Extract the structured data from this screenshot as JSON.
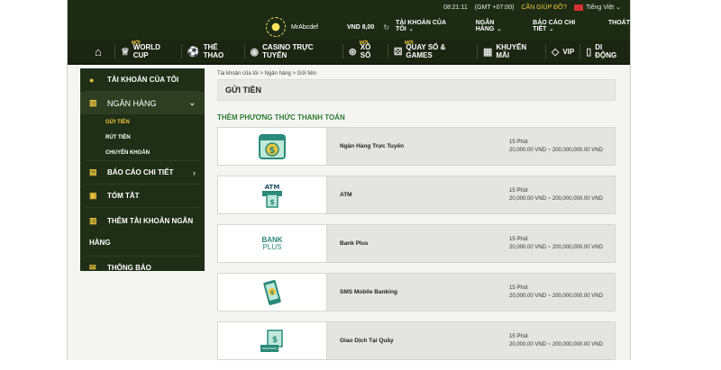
{
  "topstrip": {
    "time": "08:21:11",
    "timezone": "(GMT +07:00)",
    "help": "CẦN GIÚP ĐỠ?",
    "language": "Tiếng Việt"
  },
  "user": {
    "name": "MrAbcdef",
    "balance": "VND 8,00"
  },
  "topmenu": [
    {
      "label": "TÀI KHOẢN CỦA TÔI"
    },
    {
      "label": "NGÂN HÀNG"
    },
    {
      "label": "BÁO CÁO CHI TIẾT"
    },
    {
      "label": "THOÁT"
    }
  ],
  "mainnav": {
    "badge_new": "MỚI",
    "items": [
      {
        "label": "WORLD CUP",
        "icon": "trophy-icon"
      },
      {
        "label": "THỂ THAO",
        "icon": "soccer-ball-icon"
      },
      {
        "label": "CASINO TRỰC TUYẾN",
        "icon": "casino-chip-icon"
      },
      {
        "label": "XỔ SỐ",
        "icon": "lottery-icon"
      },
      {
        "label": "QUAY SỐ & GAMES",
        "icon": "dice-icon"
      },
      {
        "label": "KHUYẾN MÃI",
        "icon": "gift-icon"
      },
      {
        "label": "VIP",
        "icon": "diamond-icon"
      },
      {
        "label": "DI ĐỘNG",
        "icon": "mobile-icon"
      }
    ]
  },
  "sidebar": {
    "items": [
      {
        "label": "TÀI KHOẢN CỦA TÔI"
      },
      {
        "label": "NGÂN HÀNG"
      },
      {
        "label": "BÁO CÁO CHI TIẾT"
      },
      {
        "label": "TÓM TẮT"
      },
      {
        "label": "THÊM TÀI KHOẢN NGÂN HÀNG"
      },
      {
        "label": "THÔNG BÁO"
      }
    ],
    "subitems": [
      {
        "label": "GỬI TIỀN"
      },
      {
        "label": "RÚT TIỀN"
      },
      {
        "label": "CHUYỂN KHOẢN"
      }
    ]
  },
  "content": {
    "breadcrumb": "Tài khoản của tôi > Ngân hàng > Gửi tiền",
    "title": "GỬI TIỀN",
    "section": "THÊM PHƯƠNG THỨC THANH TOÁN",
    "methods": [
      {
        "name": "Ngân Hàng Trực Tuyến",
        "time": "15 Phút",
        "range": "20,000.00 VND ~ 200,000,000.00 VND",
        "icon": "online-banking-icon"
      },
      {
        "name": "ATM",
        "time": "15 Phút",
        "range": "20,000.00 VND ~ 200,000,000.00 VND",
        "icon": "atm-icon",
        "logo_text": "ATM"
      },
      {
        "name": "Bank Plus",
        "time": "15 Phút",
        "range": "20,000.00 VND ~ 200,000,000.00 VND",
        "icon": "bankplus-logo",
        "logo_line1": "BANK",
        "logo_line2": "PLUS"
      },
      {
        "name": "SMS Mobile Banking",
        "time": "15 Phút",
        "range": "20,000.00 VND ~ 200,000,000.00 VND",
        "icon": "sms-mobile-icon"
      },
      {
        "name": "Giao Dịch Tại Quầy",
        "time": "15 Phút",
        "range": "20,000.00 VND ~ 200,000,000.00 VND",
        "icon": "counter-cash-icon"
      }
    ]
  },
  "colors": {
    "header_bg": "#1d2b14",
    "sidebar_bg": "#1f2e16",
    "accent_gold": "#f0c63c",
    "section_green": "#2e7d32",
    "icon_green": "#2b8a7a"
  }
}
